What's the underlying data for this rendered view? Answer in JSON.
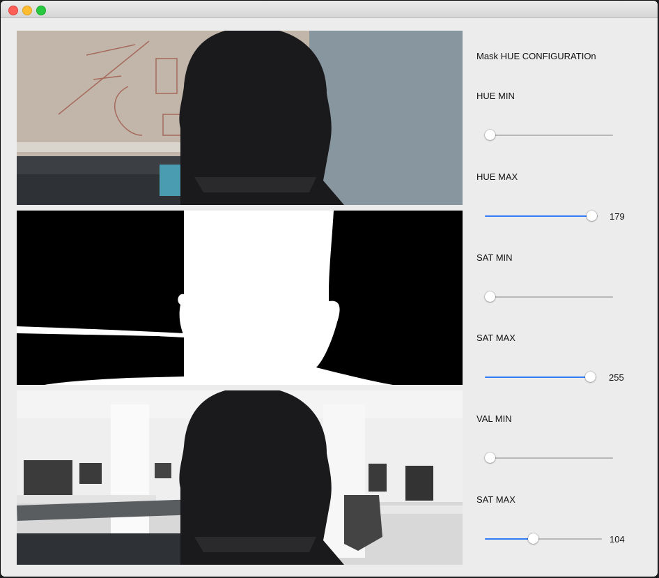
{
  "window": {
    "traffic_lights": {
      "close": "#fe5f57",
      "minimize": "#febc2e",
      "zoom": "#28c840"
    }
  },
  "feeds": {
    "raw_camera": "raw-camera-feed",
    "mask": "binary-mask-feed",
    "composite": "office-background-composite-feed"
  },
  "controls": {
    "title": "Mask HUE CONFIGURATIOn",
    "sliders": [
      {
        "label": "HUE MIN",
        "value": 0,
        "max": 179,
        "value_text": "",
        "fill": false
      },
      {
        "label": "HUE MAX",
        "value": 179,
        "max": 179,
        "value_text": "179",
        "fill": true
      },
      {
        "label": "SAT MIN",
        "value": 0,
        "max": 255,
        "value_text": "",
        "fill": false
      },
      {
        "label": "SAT MAX",
        "value": 255,
        "max": 255,
        "value_text": "255",
        "fill": true
      },
      {
        "label": "VAL MIN",
        "value": 0,
        "max": 255,
        "value_text": "",
        "fill": false
      },
      {
        "label": "SAT MAX",
        "value": 104,
        "max": 255,
        "value_text": "104",
        "fill": true
      }
    ],
    "accent_color": "#2f7cf6"
  }
}
